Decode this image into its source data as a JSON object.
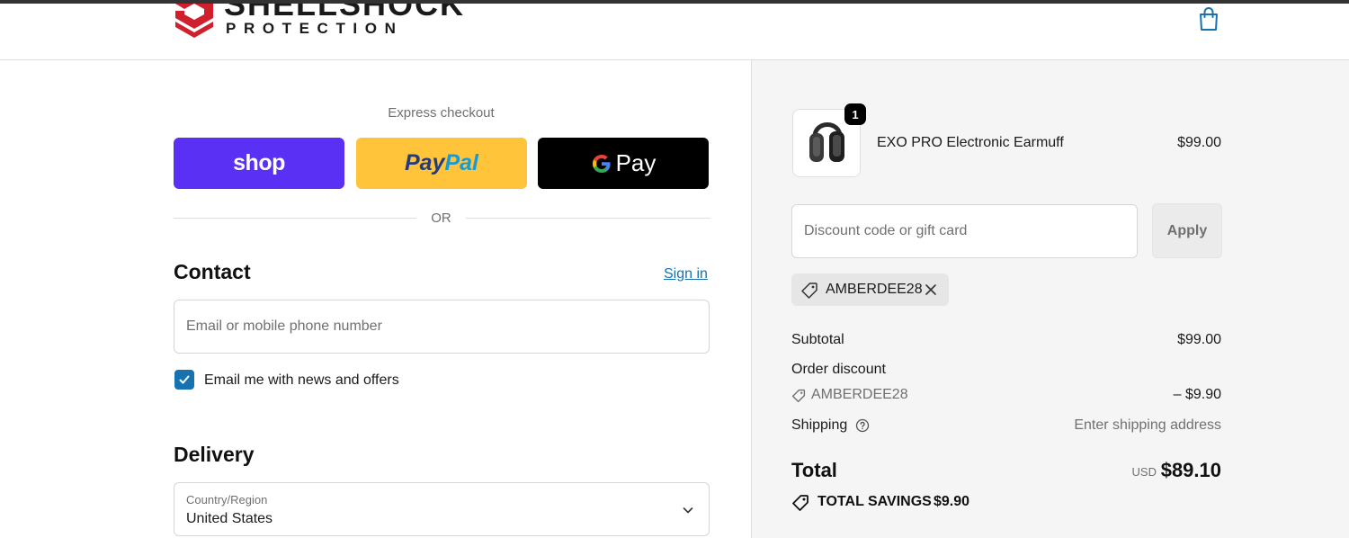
{
  "brand": {
    "name_line1": "SHELLSHOCK",
    "name_line2": "PROTECTION",
    "colors": {
      "mark": "#d0202e",
      "text": "#1a1a1a"
    }
  },
  "header": {
    "cart_icon": "shopping-bag-icon"
  },
  "express": {
    "title": "Express checkout",
    "buttons": [
      {
        "name": "shop",
        "label": "shop",
        "color": "#5a31f4"
      },
      {
        "name": "paypal",
        "label_part1": "Pay",
        "label_part2": "Pal",
        "color": "#ffc439"
      },
      {
        "name": "google-pay",
        "label": "Pay",
        "color": "#000000"
      }
    ],
    "divider_text": "OR"
  },
  "contact": {
    "title": "Contact",
    "sign_in": "Sign in",
    "email_placeholder": "Email or mobile phone number",
    "news_checkbox": {
      "label": "Email me with news and offers",
      "checked": true
    }
  },
  "delivery": {
    "title": "Delivery",
    "country_label": "Country/Region",
    "country_value": "United States"
  },
  "order": {
    "item": {
      "name": "EXO PRO Electronic Earmuff",
      "price": "$99.00",
      "quantity": "1"
    },
    "discount": {
      "placeholder": "Discount code or gift card",
      "apply_label": "Apply",
      "applied_code": "AMBERDEE28"
    },
    "summary": {
      "subtotal_label": "Subtotal",
      "subtotal_value": "$99.00",
      "order_discount_label": "Order discount",
      "discount_code": "AMBERDEE28",
      "discount_amount": "– $9.90",
      "shipping_label": "Shipping",
      "shipping_value": "Enter shipping address",
      "total_label": "Total",
      "currency": "USD",
      "total_value": "$89.10",
      "savings_label": "TOTAL SAVINGS",
      "savings_value": "$9.90"
    }
  },
  "colors": {
    "accent": "#1773b0",
    "panel_bg": "#f5f5f5"
  }
}
